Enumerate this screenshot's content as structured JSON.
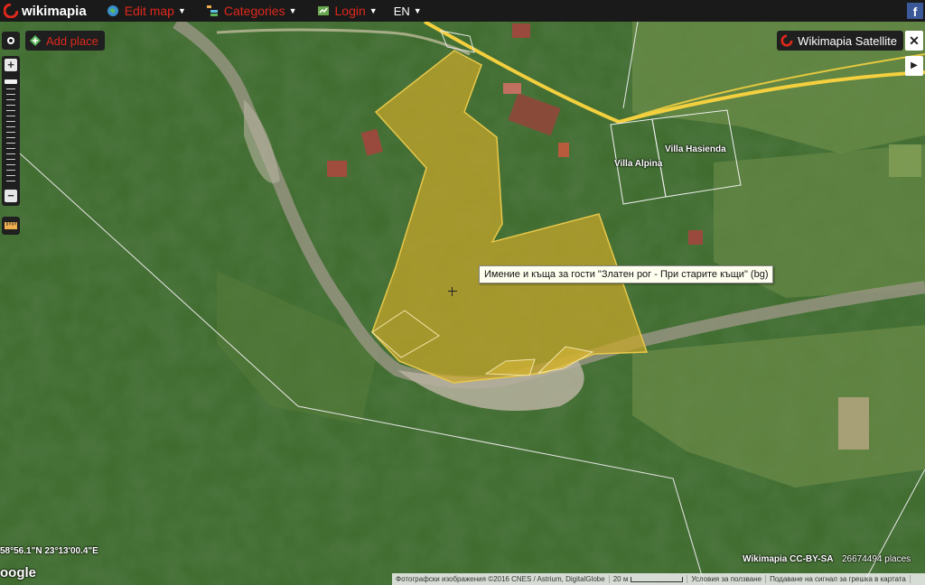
{
  "header": {
    "logo_text": "wikimapia",
    "menu": [
      {
        "label": "Edit map",
        "icon": "edit-globe-icon"
      },
      {
        "label": "Categories",
        "icon": "categories-icon"
      },
      {
        "label": "Login",
        "icon": "login-icon"
      }
    ],
    "language": "EN",
    "facebook_glyph": "f"
  },
  "controls": {
    "add_place": "Add place",
    "layer": "Wikimapia Satellite",
    "close_glyph": "✕",
    "play_glyph": "▶",
    "zoom_in": "+",
    "zoom_out": "−"
  },
  "tooltip": {
    "text": "Имение и къща за гости \"Златен рог - При старите къщи\" (bg)"
  },
  "places": [
    {
      "name": "Villa Alpina"
    },
    {
      "name": "Villa Hasienda"
    }
  ],
  "footer": {
    "coordinates": "58°56.1\"N 23°13'00.4\"E",
    "google": "oogle",
    "license": "Wikimapia CC-BY-SA",
    "place_count": "26674494 places",
    "imagery": "Фотографски изображения ©2016 CNES / Astrium, DigitalGlobe",
    "scale": "20 м",
    "terms": "Условия за ползване",
    "report": "Подаване на сигнал за грешка в картата"
  },
  "colors": {
    "highlight_fill": "#c9a62a",
    "menu_accent": "#e0281c",
    "road": "#f4d03f"
  }
}
